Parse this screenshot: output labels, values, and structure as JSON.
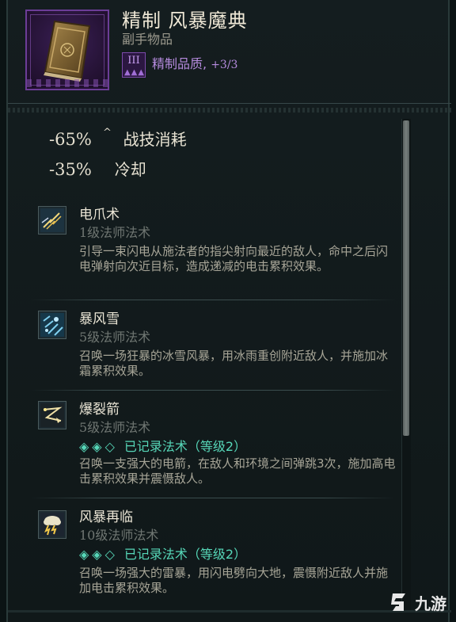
{
  "item": {
    "title": "精制 风暴魔典",
    "subtitle": "副手物品",
    "quality_badge": "III",
    "quality_dots": "▲▲▲",
    "quality_label": "精制品质,",
    "quality_value": "+3/3"
  },
  "stats": [
    {
      "value": "-65%",
      "caret": "^",
      "label": "战技消耗"
    },
    {
      "value": "-35%",
      "label": "冷却"
    }
  ],
  "spells": [
    {
      "name": "电爪术",
      "level": "1级法师法术",
      "icon": "lightning-claw-icon",
      "record": null,
      "desc": "引导一束闪电从施法者的指尖射向最近的敌人，命中之后闪电弹射向次近目标，造成递减的电击累积效果。"
    },
    {
      "name": "暴风雪",
      "level": "5级法师法术",
      "icon": "blizzard-icon",
      "record": null,
      "desc": "召唤一场狂暴的冰雪风暴，用冰雨重创附近敌人，并施加冰霜累积效果。"
    },
    {
      "name": "爆裂箭",
      "level": "5级法师法术",
      "icon": "chain-arrow-icon",
      "record": {
        "diamonds": "◈◈◇",
        "text": "已记录法术（等级2）"
      },
      "desc": "召唤一支强大的电箭，在敌人和环境之间弹跳3次，施加高电击累积效果并震慑敌人。"
    },
    {
      "name": "风暴再临",
      "level": "10级法师法术",
      "icon": "storm-cloud-icon",
      "record": {
        "diamonds": "◈◈◇",
        "text": "已记录法术（等级2）"
      },
      "desc": "召唤一场强大的雷暴，用闪电劈向大地，震慑附近敌人并施加电击累积效果。"
    }
  ],
  "watermark": {
    "text": "九游"
  },
  "colors": {
    "accent_purple": "#b68bde",
    "record_teal": "#56d7b8",
    "desc_gray": "#a7a597"
  }
}
